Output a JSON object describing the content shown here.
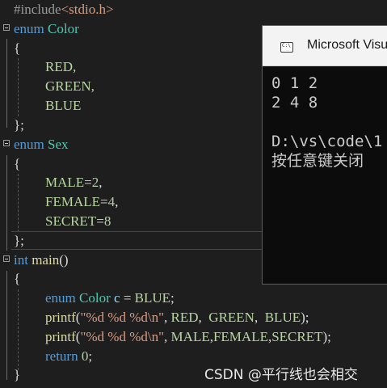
{
  "editor": {
    "line1": {
      "directive": "#include",
      "header": "<stdio.h>"
    },
    "line2": {
      "kw": "enum",
      "name": "Color"
    },
    "line3": {
      "text": "{"
    },
    "line4": {
      "text": "RED,"
    },
    "line5": {
      "text": "GREEN,"
    },
    "line6": {
      "text": "BLUE"
    },
    "line7": {
      "text": "};"
    },
    "line8": {
      "kw": "enum",
      "name": "Sex"
    },
    "line9": {
      "text": "{"
    },
    "line10": {
      "name": "MALE",
      "eq": "=",
      "val": "2",
      "end": ","
    },
    "line11": {
      "name": "FEMALE",
      "eq": "=",
      "val": "4",
      "end": ","
    },
    "line12": {
      "name": "SECRET",
      "eq": "=",
      "val": "8"
    },
    "line13": {
      "text": "};"
    },
    "line14": {
      "type": "int",
      "fn": "main",
      "rest": "()"
    },
    "line15": {
      "text": "{"
    },
    "line16": {
      "kw": "enum",
      "type": "Color",
      "var": "c",
      "eq": " = ",
      "val": "BLUE",
      "end": ";"
    },
    "line17": {
      "fn": "printf",
      "open": "(",
      "str": "\"%d %d %d\\n\"",
      "sep1": ", ",
      "a1": "RED",
      "sep2": ",  ",
      "a2": "GREEN",
      "sep3": ",  ",
      "a3": "BLUE",
      "close": ");"
    },
    "line18": {
      "fn": "printf",
      "open": "(",
      "str": "\"%d %d %d\\n\"",
      "sep1": ", ",
      "a1": "MALE",
      "sep2": ",",
      "a2": "FEMALE",
      "sep3": ",",
      "a3": "SECRET",
      "close": ");"
    },
    "line19": {
      "kw": "return",
      "val": " 0",
      "end": ";"
    },
    "line20": {
      "text": "}"
    }
  },
  "console": {
    "title": "Microsoft Visu",
    "line1": "0 1 2",
    "line2": "2 4 8",
    "line3": "",
    "line4": "D:\\vs\\code\\1",
    "line5": "按任意键关闭"
  },
  "watermark": "CSDN @平行线也会相交",
  "colors": {
    "background": "#1e1e1e",
    "keyword": "#569cd6",
    "type": "#4ec9b0",
    "enum_constant": "#b8d7a3",
    "function": "#dcdcaa",
    "string": "#d69d85",
    "number": "#b5cea8",
    "variable": "#9cdcfe",
    "console_bg": "#0c0c0c"
  }
}
